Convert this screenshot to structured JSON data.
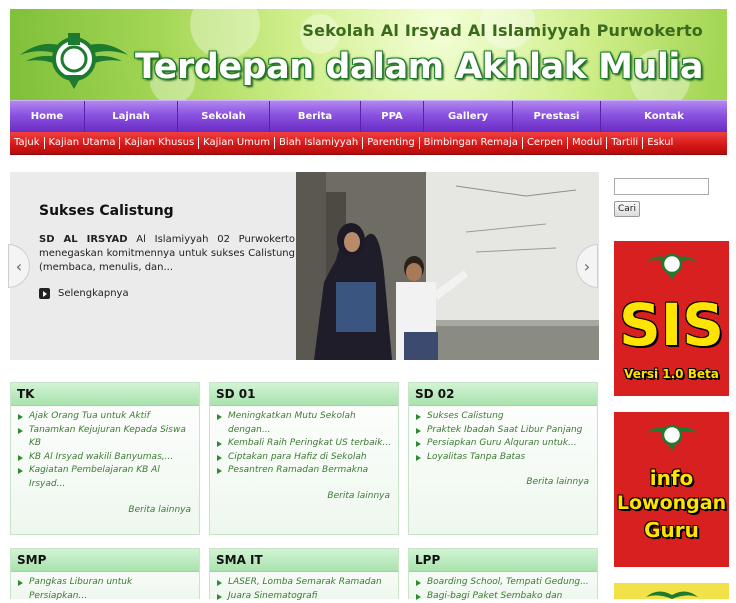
{
  "header": {
    "school_name": "Sekolah Al Irsyad Al Islamiyyah Purwokerto",
    "tagline": "Terdepan dalam Akhlak Mulia",
    "logo_icon": "al-irsyad-logo-icon"
  },
  "main_nav": [
    "Home",
    "Lajnah",
    "Sekolah",
    "Berita",
    "PPA",
    "Gallery",
    "Prestasi",
    "Kontak"
  ],
  "sub_nav": [
    "Tajuk",
    "Kajian Utama",
    "Kajian Khusus",
    "Kajian Umum",
    "Biah Islamiyyah",
    "Parenting",
    "Bimbingan Remaja",
    "Cerpen",
    "Modul",
    "Tartili",
    "Eskul"
  ],
  "slider": {
    "title": "Sukses Calistung",
    "text_bold": "SD AL IRSYAD",
    "text": " Al Islamiyyah 02 Purwokerto menegaskan komitmennya untuk sukses Calistung (membaca, menulis, dan...",
    "more_label": "Selengkapnya",
    "prev_icon": "chevron-left-icon",
    "next_icon": "chevron-right-icon"
  },
  "sidebar": {
    "search_placeholder": "",
    "search_button": "Cari",
    "banner_sis": {
      "big": "SIS",
      "small": "Versi 1.0 Beta"
    },
    "banner_info": {
      "line1": "info",
      "line2": "Lowongan",
      "line3": "Guru"
    }
  },
  "boxes": [
    {
      "title": "TK",
      "items": [
        "Ajak Orang Tua untuk Aktif",
        "Tanamkan Kejujuran Kepada Siswa KB",
        "KB Al Irsyad wakili Banyumas,...",
        "Kagiatan Pembelajaran KB Al Irsyad..."
      ],
      "more": "Berita lainnya"
    },
    {
      "title": "SD 01",
      "items": [
        "Meningkatkan Mutu Sekolah dengan...",
        "Kembali Raih Peringkat US terbaik...",
        "Ciptakan para Hafiz di Sekolah",
        "Pesantren Ramadan Bermakna"
      ],
      "more": "Berita lainnya"
    },
    {
      "title": "SD 02",
      "items": [
        "Sukses Calistung",
        "Praktek Ibadah Saat Libur Panjang",
        "Persiapkan Guru Alquran untuk...",
        "Loyalitas Tanpa Batas"
      ],
      "more": "Berita lainnya"
    },
    {
      "title": "SMP",
      "items": [
        "Pangkas Liburan untuk Persiapkan..."
      ],
      "more": ""
    },
    {
      "title": "SMA IT",
      "items": [
        "LASER, Lomba Semarak Ramadan",
        "Juara Sinematografi"
      ],
      "more": ""
    },
    {
      "title": "LPP",
      "items": [
        "Boarding School, Tempati Gedung...",
        "Bagi-bagi Paket Sembako dan"
      ],
      "more": ""
    }
  ],
  "colors": {
    "nav_purple": "#8a52e0",
    "subnav_red": "#d41616",
    "box_green": "#a9e2ad",
    "link_green": "#3d7a34"
  }
}
